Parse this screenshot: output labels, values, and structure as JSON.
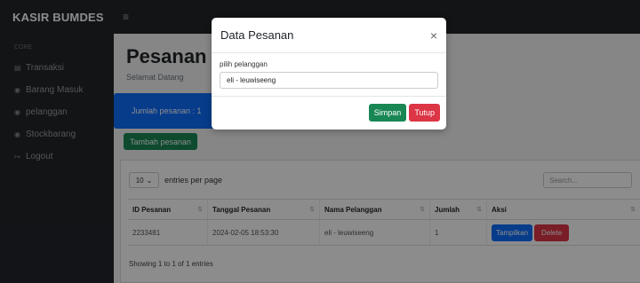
{
  "app": {
    "brand": "KASIR BUMDES",
    "menu_toggle": "≡"
  },
  "sidebar": {
    "heading": "CORE",
    "items": [
      {
        "icon": "receipt-icon",
        "glyph": "▤",
        "label": "Transaksi"
      },
      {
        "icon": "box-icon",
        "glyph": "◉",
        "label": "Barang Masuk"
      },
      {
        "icon": "user-icon",
        "glyph": "◉",
        "label": "pelanggan"
      },
      {
        "icon": "stock-icon",
        "glyph": "◉",
        "label": "Stockbarang"
      },
      {
        "icon": "logout-icon",
        "glyph": "↦",
        "label": "Logout"
      }
    ]
  },
  "page": {
    "title": "Pesanan",
    "subtitle": "Selamat Datang",
    "summary_card": "Jumlah pesanan : 1",
    "add_button": "Tambah pesanan"
  },
  "table": {
    "per_page_value": "10",
    "per_page_suffix": "entries per page",
    "search_placeholder": "Search...",
    "columns": [
      "ID Pesanan",
      "Tanggal Pesanan",
      "Nama Pelanggan",
      "Jumlah",
      "Aksi"
    ],
    "rows": [
      {
        "id": "2233481",
        "tanggal": "2024-02-05 18:53:30",
        "nama": "eli - leuwiseeng",
        "jumlah": "1",
        "btn_view": "Tampilkan",
        "btn_delete": "Delete"
      }
    ],
    "info": "Showing 1 to 1 of 1 entries"
  },
  "modal": {
    "title": "Data Pesanan",
    "close_glyph": "×",
    "field_label": "pilih pelanggan",
    "field_value": "eli - leuwiseeng",
    "save_label": "Simpan",
    "close_label": "Tutup"
  },
  "colors": {
    "primary": "#0d6efd",
    "success": "#198754",
    "danger": "#dc3545",
    "dark": "#212529"
  }
}
